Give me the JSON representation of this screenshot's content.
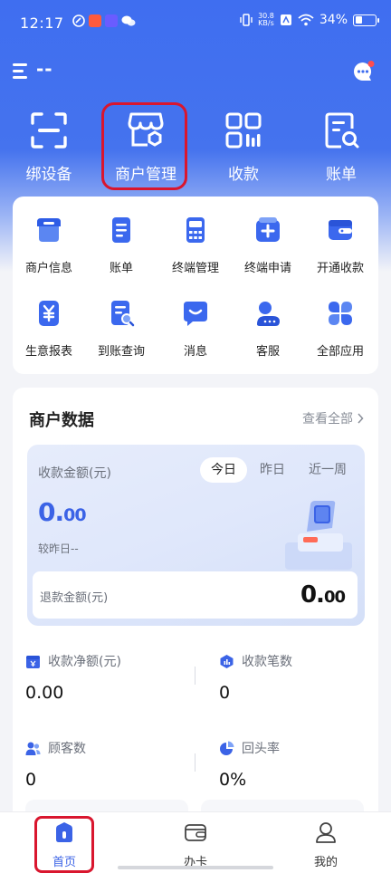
{
  "status_bar": {
    "time": "12:17",
    "net_speed": "30.8",
    "net_unit": "KB/s",
    "battery": "34%",
    "battery_level": 0.34
  },
  "header": {
    "store_name": "--"
  },
  "quick_actions": [
    {
      "label": "绑设备",
      "icon": "scan-frame-icon"
    },
    {
      "label": "商户管理",
      "icon": "store-settings-icon"
    },
    {
      "label": "收款",
      "icon": "qr-code-icon"
    },
    {
      "label": "账单",
      "icon": "bill-search-icon"
    }
  ],
  "services": [
    {
      "label": "商户信息",
      "icon": "merchant-info-icon"
    },
    {
      "label": "账单",
      "icon": "bill-icon"
    },
    {
      "label": "终端管理",
      "icon": "terminal-icon"
    },
    {
      "label": "终端申请",
      "icon": "terminal-apply-icon"
    },
    {
      "label": "开通收款",
      "icon": "wallet-icon"
    },
    {
      "label": "生意报表",
      "icon": "yuan-report-icon"
    },
    {
      "label": "到账查询",
      "icon": "arrival-query-icon"
    },
    {
      "label": "消息",
      "icon": "message-icon"
    },
    {
      "label": "客服",
      "icon": "service-icon"
    },
    {
      "label": "全部应用",
      "icon": "all-apps-icon"
    }
  ],
  "merchant_data": {
    "title": "商户数据",
    "view_all": "查看全部",
    "amount_label": "收款金额(元)",
    "tabs": [
      "今日",
      "昨日",
      "近一周"
    ],
    "active_tab": "今日",
    "amount_int": "0.",
    "amount_dec": "00",
    "compare_text": "较昨日--",
    "refund_label": "退款金额(元)",
    "refund_int": "0.",
    "refund_dec": "00",
    "stats": [
      {
        "label": "收款净额(元)",
        "value": "0.00",
        "icon": "yuan-box-icon"
      },
      {
        "label": "收款笔数",
        "value": "0",
        "icon": "count-hex-icon"
      },
      {
        "label": "顾客数",
        "value": "0",
        "icon": "users-icon"
      },
      {
        "label": "回头率",
        "value": "0%",
        "icon": "pie-icon"
      }
    ]
  },
  "tabbar": [
    {
      "label": "首页",
      "icon": "home-icon",
      "active": true
    },
    {
      "label": "办卡",
      "icon": "card-icon",
      "active": false
    },
    {
      "label": "我的",
      "icon": "profile-icon",
      "active": false
    }
  ],
  "colors": {
    "primary": "#3b63e6",
    "highlight": "#d9162e"
  }
}
